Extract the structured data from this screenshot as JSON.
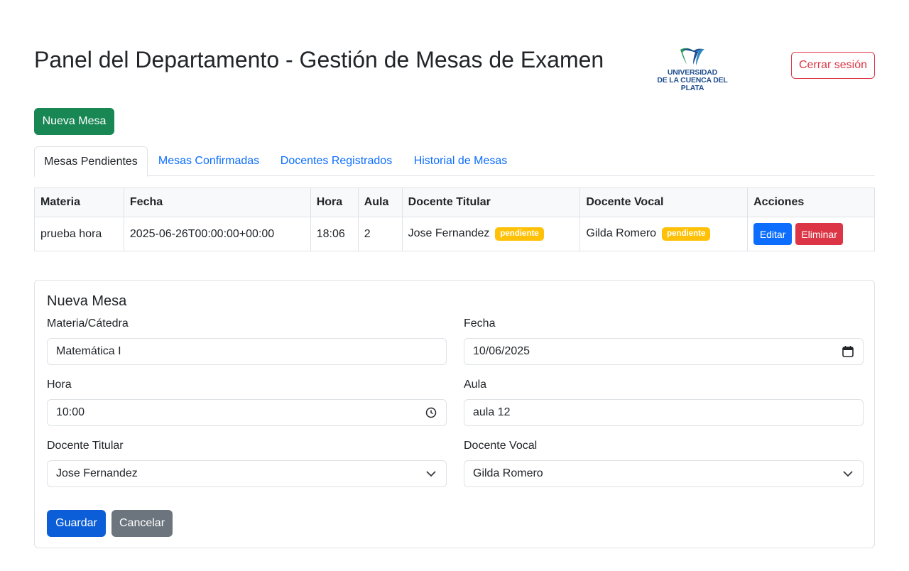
{
  "header": {
    "title": "Panel del Departamento - Gestión de Mesas de Examen",
    "logo_line1": "UNIVERSIDAD",
    "logo_line2": "DE LA CUENCA DEL PLATA",
    "logout_label": "Cerrar sesión"
  },
  "toolbar": {
    "new_label": "Nueva Mesa"
  },
  "tabs": [
    {
      "label": "Mesas Pendientes",
      "active": true
    },
    {
      "label": "Mesas Confirmadas",
      "active": false
    },
    {
      "label": "Docentes Registrados",
      "active": false
    },
    {
      "label": "Historial de Mesas",
      "active": false
    }
  ],
  "table": {
    "headers": [
      "Materia",
      "Fecha",
      "Hora",
      "Aula",
      "Docente Titular",
      "Docente Vocal",
      "Acciones"
    ],
    "rows": [
      {
        "materia": "prueba hora",
        "fecha": "2025-06-26T00:00:00+00:00",
        "hora": "18:06",
        "aula": "2",
        "titular": "Jose Fernandez",
        "titular_status": "pendiente",
        "vocal": "Gilda Romero",
        "vocal_status": "pendiente",
        "edit_label": "Editar",
        "delete_label": "Eliminar"
      }
    ]
  },
  "form": {
    "title": "Nueva Mesa",
    "materia_label": "Materia/Cátedra",
    "materia_value": "Matemática I",
    "fecha_label": "Fecha",
    "fecha_value": "10/06/2025",
    "hora_label": "Hora",
    "hora_value": "10:00",
    "aula_label": "Aula",
    "aula_value": "aula 12",
    "titular_label": "Docente Titular",
    "titular_value": "Jose Fernandez",
    "vocal_label": "Docente Vocal",
    "vocal_value": "Gilda Romero",
    "save_label": "Guardar",
    "cancel_label": "Cancelar"
  },
  "colors": {
    "primary": "#0d6efd",
    "success": "#198754",
    "danger": "#dc3545",
    "warning": "#ffc107",
    "secondary": "#6c757d"
  },
  "icons": [
    "calendar-icon",
    "clock-icon",
    "chevron-down-icon",
    "university-logo"
  ]
}
